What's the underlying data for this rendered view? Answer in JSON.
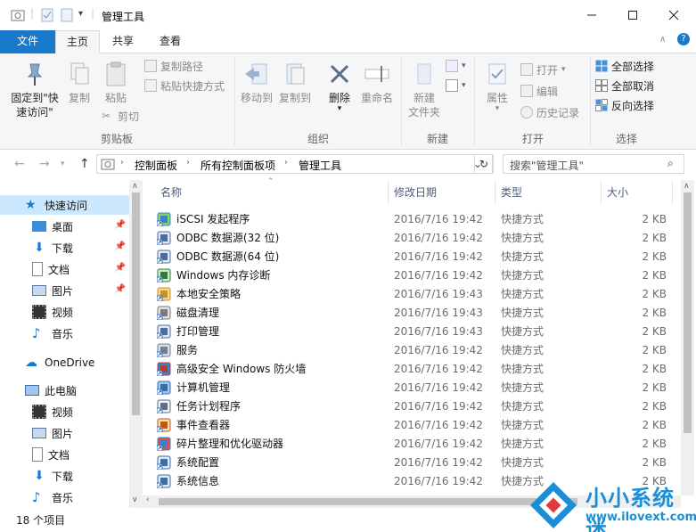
{
  "window": {
    "title": "管理工具"
  },
  "tabs": [
    {
      "label": "文件"
    },
    {
      "label": "主页"
    },
    {
      "label": "共享"
    },
    {
      "label": "查看"
    }
  ],
  "ribbon": {
    "pin_quick_access": "固定到\"快\n速访问\"",
    "copy": "复制",
    "paste": "粘贴",
    "copy_path": "复制路径",
    "paste_shortcut": "粘贴快捷方式",
    "cut": "剪切",
    "clipboard_group": "剪贴板",
    "move_to": "移动到",
    "copy_to": "复制到",
    "delete": "删除",
    "rename": "重命名",
    "organize_group": "组织",
    "new_folder": "新建\n文件夹",
    "new_group": "新建",
    "properties": "属性",
    "open": "打开",
    "edit": "编辑",
    "history": "历史记录",
    "open_group": "打开",
    "select_all": "全部选择",
    "select_none": "全部取消",
    "invert_selection": "反向选择",
    "select_group": "选择"
  },
  "address": {
    "crumbs": [
      "控制面板",
      "所有控制面板项",
      "管理工具"
    ],
    "search_placeholder": "搜索\"管理工具\""
  },
  "nav": {
    "quick_access": "快速访问",
    "items": [
      {
        "label": "桌面",
        "pinned": true
      },
      {
        "label": "下载",
        "pinned": true
      },
      {
        "label": "文档",
        "pinned": true
      },
      {
        "label": "图片",
        "pinned": true
      },
      {
        "label": "视频"
      },
      {
        "label": "音乐"
      }
    ],
    "onedrive": "OneDrive",
    "this_pc": "此电脑",
    "pc_items": [
      {
        "label": "视频"
      },
      {
        "label": "图片"
      },
      {
        "label": "文档"
      },
      {
        "label": "下载"
      },
      {
        "label": "音乐"
      }
    ]
  },
  "columns": {
    "name": "名称",
    "date": "修改日期",
    "type": "类型",
    "size": "大小"
  },
  "files": [
    {
      "name": "iSCSI 发起程序",
      "date": "2016/7/16 19:42",
      "type": "快捷方式",
      "size": "2 KB",
      "icon": "globe-icon"
    },
    {
      "name": "ODBC 数据源(32 位)",
      "date": "2016/7/16 19:42",
      "type": "快捷方式",
      "size": "2 KB",
      "icon": "database-icon"
    },
    {
      "name": "ODBC 数据源(64 位)",
      "date": "2016/7/16 19:42",
      "type": "快捷方式",
      "size": "2 KB",
      "icon": "database-icon"
    },
    {
      "name": "Windows 内存诊断",
      "date": "2016/7/16 19:42",
      "type": "快捷方式",
      "size": "2 KB",
      "icon": "memory-icon"
    },
    {
      "name": "本地安全策略",
      "date": "2016/7/16 19:43",
      "type": "快捷方式",
      "size": "2 KB",
      "icon": "security-icon"
    },
    {
      "name": "磁盘清理",
      "date": "2016/7/16 19:43",
      "type": "快捷方式",
      "size": "2 KB",
      "icon": "disk-icon"
    },
    {
      "name": "打印管理",
      "date": "2016/7/16 19:43",
      "type": "快捷方式",
      "size": "2 KB",
      "icon": "printer-icon"
    },
    {
      "name": "服务",
      "date": "2016/7/16 19:42",
      "type": "快捷方式",
      "size": "2 KB",
      "icon": "gear-icon"
    },
    {
      "name": "高级安全 Windows 防火墙",
      "date": "2016/7/16 19:42",
      "type": "快捷方式",
      "size": "2 KB",
      "icon": "firewall-icon"
    },
    {
      "name": "计算机管理",
      "date": "2016/7/16 19:42",
      "type": "快捷方式",
      "size": "2 KB",
      "icon": "computer-icon"
    },
    {
      "name": "任务计划程序",
      "date": "2016/7/16 19:42",
      "type": "快捷方式",
      "size": "2 KB",
      "icon": "clock-icon"
    },
    {
      "name": "事件查看器",
      "date": "2016/7/16 19:42",
      "type": "快捷方式",
      "size": "2 KB",
      "icon": "event-icon"
    },
    {
      "name": "碎片整理和优化驱动器",
      "date": "2016/7/16 19:42",
      "type": "快捷方式",
      "size": "2 KB",
      "icon": "defrag-icon"
    },
    {
      "name": "系统配置",
      "date": "2016/7/16 19:42",
      "type": "快捷方式",
      "size": "2 KB",
      "icon": "config-icon"
    },
    {
      "name": "系统信息",
      "date": "2016/7/16 19:42",
      "type": "快捷方式",
      "size": "2 KB",
      "icon": "info-icon"
    }
  ],
  "status": {
    "count": "18 个项目"
  },
  "watermark": {
    "brand": "小小系统迷",
    "url": "www.ilovext.com"
  },
  "colors": {
    "accent": "#1979ca",
    "selection": "#cce8ff",
    "watermark_blue": "#1a8fd8"
  }
}
